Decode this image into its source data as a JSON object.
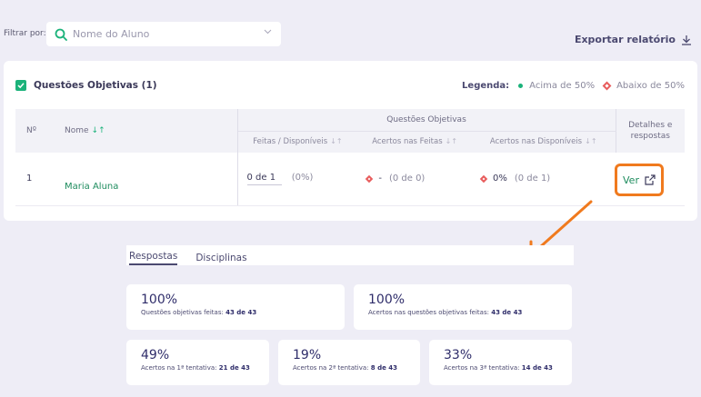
{
  "filter": {
    "label": "Filtrar por:",
    "placeholder": "Nome do Aluno"
  },
  "export_label": "Exportar relatório",
  "section": {
    "title": "Questões Objetivas (1)"
  },
  "legend": {
    "label": "Legenda:",
    "above": "Acima de 50%",
    "below": "Abaixo de 50%",
    "above_color": "#1bb27a",
    "below_color": "#e85c5c"
  },
  "table": {
    "col_num": "Nº",
    "col_name": "Nome",
    "group_header": "Questões Objetivas",
    "sub_done": "Feitas / Disponíveis",
    "sub_correct_done": "Acertos nas Feitas",
    "sub_correct_avail": "Acertos nas Disponíveis",
    "col_details_1": "Detalhes e",
    "col_details_2": "respostas",
    "rows": [
      {
        "num": "1",
        "name": "Maria Aluna",
        "done": "0 de 1",
        "done_pct": "(0%)",
        "correct_done": "-",
        "correct_done_detail": "(0 de 0)",
        "correct_avail": "0%",
        "correct_avail_detail": "(0 de 1)",
        "action": "Ver"
      }
    ]
  },
  "tabs": [
    {
      "label": "Respostas",
      "active": true
    },
    {
      "label": "Disciplinas",
      "active": false
    }
  ],
  "stats": [
    {
      "value": "100%",
      "label": "Questões objetivas feitas:",
      "detail": "43 de 43"
    },
    {
      "value": "100%",
      "label": "Acertos nas questões objetivas feitas:",
      "detail": "43 de 43"
    },
    {
      "value": "49%",
      "label": "Acertos na 1ª tentativa:",
      "detail": "21 de 43"
    },
    {
      "value": "19%",
      "label": "Acertos na 2ª tentativa:",
      "detail": "8 de 43"
    },
    {
      "value": "33%",
      "label": "Acertos na 3ª tentativa:",
      "detail": "14 de 43"
    }
  ],
  "accent_color": "#f07a1e",
  "icons": {
    "search": "search-icon",
    "chevron": "chevron-down-icon",
    "download": "download-icon",
    "external": "external-link-icon",
    "sort": "sort-icon"
  }
}
